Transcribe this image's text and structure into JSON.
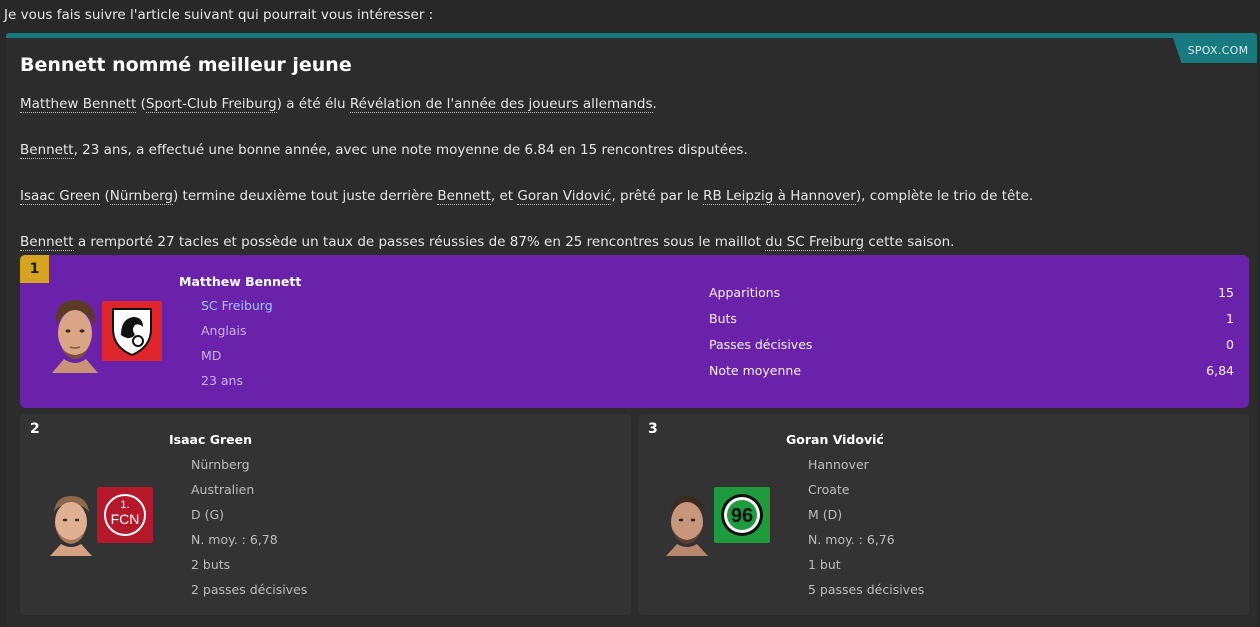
{
  "intro": "Je vous fais suivre l'article suivant qui pourrait vous intéresser :",
  "source": "SPOX.COM",
  "headline": "Bennett nommé meilleur jeune",
  "paragraphs": {
    "p1": {
      "a": "Matthew Bennett",
      "b": " (",
      "c": "Sport-Club Freiburg",
      "d": ") a été élu ",
      "e": "Révélation de l'année des joueurs allemands",
      "f": "."
    },
    "p2": {
      "a": "Bennett",
      "b": ", 23 ans, a effectué une bonne année, avec une note moyenne de 6.84 en 15 rencontres disputées."
    },
    "p3": {
      "a": "Isaac Green",
      "b": " (",
      "c": "Nürnberg",
      "d": ") termine deuxième tout juste derrière ",
      "e": "Bennett",
      "f": ", et ",
      "g": "Goran Vidović",
      "h": ", prêté par le ",
      "i": "RB Leipzig à Hannover",
      "j": "), complète le trio de tête."
    },
    "p4": {
      "a": "Bennett",
      "b": " a remporté 27 tacles et possède un taux de passes réussies de 87% en 25 rencontres sous le maillot ",
      "c": "du SC Freiburg",
      "d": " cette saison."
    }
  },
  "first": {
    "rank": "1",
    "name": "Matthew Bennett",
    "club": "SC Freiburg",
    "nationality": "Anglais",
    "position": "MD",
    "age": "23 ans",
    "crest_icon": "freiburg-crest-icon",
    "stats": [
      {
        "label": "Apparitions",
        "value": "15"
      },
      {
        "label": "Buts",
        "value": "1"
      },
      {
        "label": "Passes décisives",
        "value": "0"
      },
      {
        "label": "Note moyenne",
        "value": "6,84"
      }
    ]
  },
  "second": {
    "rank": "2",
    "name": "Isaac Green",
    "club": "Nürnberg",
    "nationality": "Australien",
    "position": "D (G)",
    "rating": "N. moy. : 6,78",
    "goals": "2 buts",
    "assists": "2 passes décisives",
    "crest_icon": "fcn-crest-icon",
    "crest_text": "FCN",
    "crest_num": "1."
  },
  "third": {
    "rank": "3",
    "name": "Goran Vidović",
    "club": "Hannover",
    "nationality": "Croate",
    "position": "M (D)",
    "rating": "N. moy. : 6,76",
    "goals": "1 but",
    "assists": "5 passes décisives",
    "crest_icon": "hannover96-crest-icon",
    "crest_text": "96"
  },
  "colors": {
    "accent_teal": "#187a7e",
    "first_bg": "#6a22ab",
    "rank_gold": "#d6a323",
    "club_link": "#9cc6ff"
  }
}
